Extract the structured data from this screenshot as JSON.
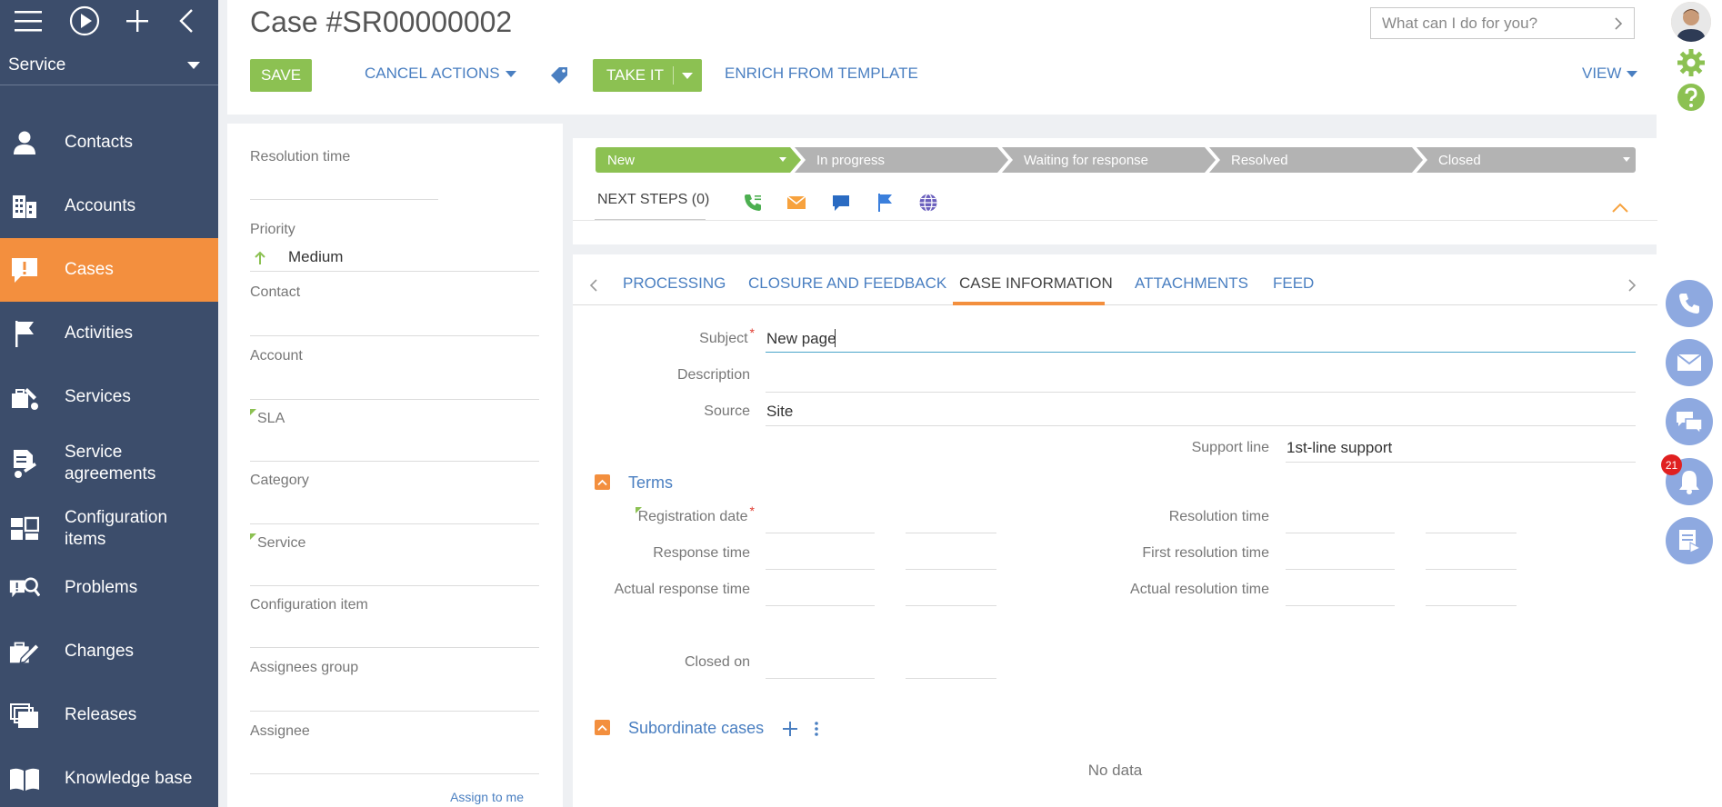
{
  "sidebar": {
    "workspace": "Service",
    "items": [
      {
        "label": "Contacts",
        "icon": "contact-icon"
      },
      {
        "label": "Accounts",
        "icon": "building-icon"
      },
      {
        "label": "Cases",
        "icon": "case-alert-icon",
        "active": true
      },
      {
        "label": "Activities",
        "icon": "flag-icon"
      },
      {
        "label": "Services",
        "icon": "services-icon"
      },
      {
        "label": "Service agreements",
        "icon": "agreement-icon"
      },
      {
        "label": "Configuration items",
        "icon": "config-items-icon"
      },
      {
        "label": "Problems",
        "icon": "problem-search-icon"
      },
      {
        "label": "Changes",
        "icon": "change-pen-icon"
      },
      {
        "label": "Releases",
        "icon": "releases-icon"
      },
      {
        "label": "Knowledge base",
        "icon": "book-icon"
      }
    ]
  },
  "header": {
    "title": "Case #SR00000002",
    "search_placeholder": "What can I do for you?",
    "save_label": "SAVE",
    "cancel_label": "CANCEL",
    "actions_label": "ACTIONS",
    "take_it_label": "TAKE IT",
    "enrich_label": "ENRICH FROM TEMPLATE",
    "view_label": "VIEW"
  },
  "left_panel": {
    "resolution_time_label": "Resolution time",
    "priority_label": "Priority",
    "priority_value": "Medium",
    "contact_label": "Contact",
    "account_label": "Account",
    "sla_label": "SLA",
    "category_label": "Category",
    "service_label": "Service",
    "config_item_label": "Configuration item",
    "assignees_group_label": "Assignees group",
    "assignee_label": "Assignee",
    "assign_to_me": "Assign to me"
  },
  "stages": [
    "New",
    "In progress",
    "Waiting for response",
    "Resolved",
    "Closed"
  ],
  "next_steps": {
    "label": "NEXT STEPS (0)"
  },
  "tabs": [
    "PROCESSING",
    "CLOSURE AND FEEDBACK",
    "CASE INFORMATION",
    "ATTACHMENTS",
    "FEED"
  ],
  "case_info": {
    "subject_label": "Subject",
    "subject_value": "New page",
    "description_label": "Description",
    "source_label": "Source",
    "source_value": "Site",
    "support_line_label": "Support line",
    "support_line_value": "1st-line support"
  },
  "terms": {
    "title": "Terms",
    "registration_date_label": "Registration date",
    "response_time_label": "Response time",
    "actual_response_time_label": "Actual response time",
    "closed_on_label": "Closed on",
    "resolution_time_label": "Resolution time",
    "first_resolution_time_label": "First resolution time",
    "actual_resolution_time_label": "Actual resolution time"
  },
  "subordinate": {
    "title": "Subordinate cases",
    "empty_text": "No data"
  },
  "notifications": {
    "count": "21"
  },
  "colors": {
    "sidebar": "#3c4d6b",
    "accent_orange": "#f38f3e",
    "green": "#8cc152",
    "link_blue": "#4a7fc1",
    "rail_blue": "#8ea9e0"
  }
}
